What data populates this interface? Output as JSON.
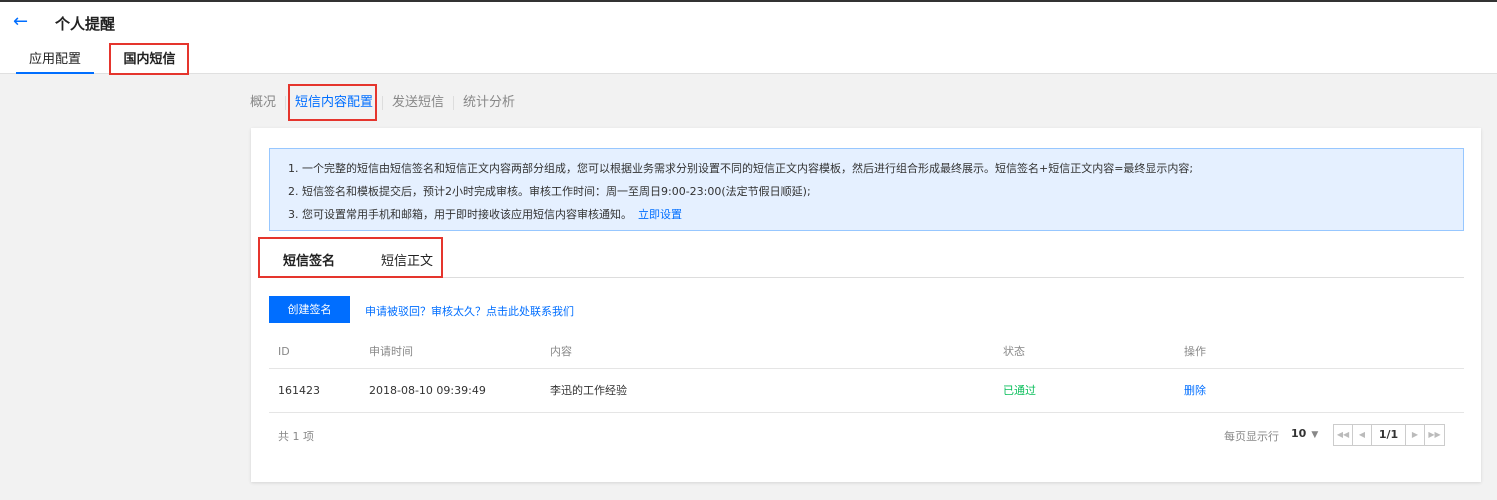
{
  "header": {
    "back_icon": "arrow-left-icon",
    "title": "个人提醒",
    "tabs": [
      {
        "label": "应用配置"
      },
      {
        "label": "国内短信"
      }
    ]
  },
  "subnav": {
    "items": [
      {
        "label": "概况"
      },
      {
        "label": "短信内容配置"
      },
      {
        "label": "发送短信"
      },
      {
        "label": "统计分析"
      }
    ]
  },
  "notice": {
    "line1": "1. 一个完整的短信由短信签名和短信正文内容两部分组成，您可以根据业务需求分别设置不同的短信正文内容模板，然后进行组合形成最终展示。短信签名+短信正文内容=最终显示内容;",
    "line2": "2. 短信签名和模板提交后，预计2小时完成审核。审核工作时间：周一至周日9:00-23:00(法定节假日顺延);",
    "line3": "3. 您可设置常用手机和邮箱，用于即时接收该应用短信内容审核通知。",
    "link": "立即设置"
  },
  "inner_tabs": [
    {
      "label": "短信签名"
    },
    {
      "label": "短信正文"
    }
  ],
  "actions": {
    "create_label": "创建签名",
    "help_link": "申请被驳回？审核太久？点击此处联系我们"
  },
  "table": {
    "columns": [
      "ID",
      "申请时间",
      "内容",
      "状态",
      "操作"
    ],
    "rows": [
      {
        "id": "161423",
        "time": "2018-08-10 09:39:49",
        "content": "李迅的工作经验",
        "status": "已通过",
        "action": "删除"
      }
    ]
  },
  "footer": {
    "total": "共 1 项",
    "per_page_label": "每页显示行",
    "per_page_value": "10",
    "page": "1/1"
  },
  "colors": {
    "accent": "#006eff",
    "success": "#0abf5b",
    "highlight_box": "#e5352d"
  }
}
